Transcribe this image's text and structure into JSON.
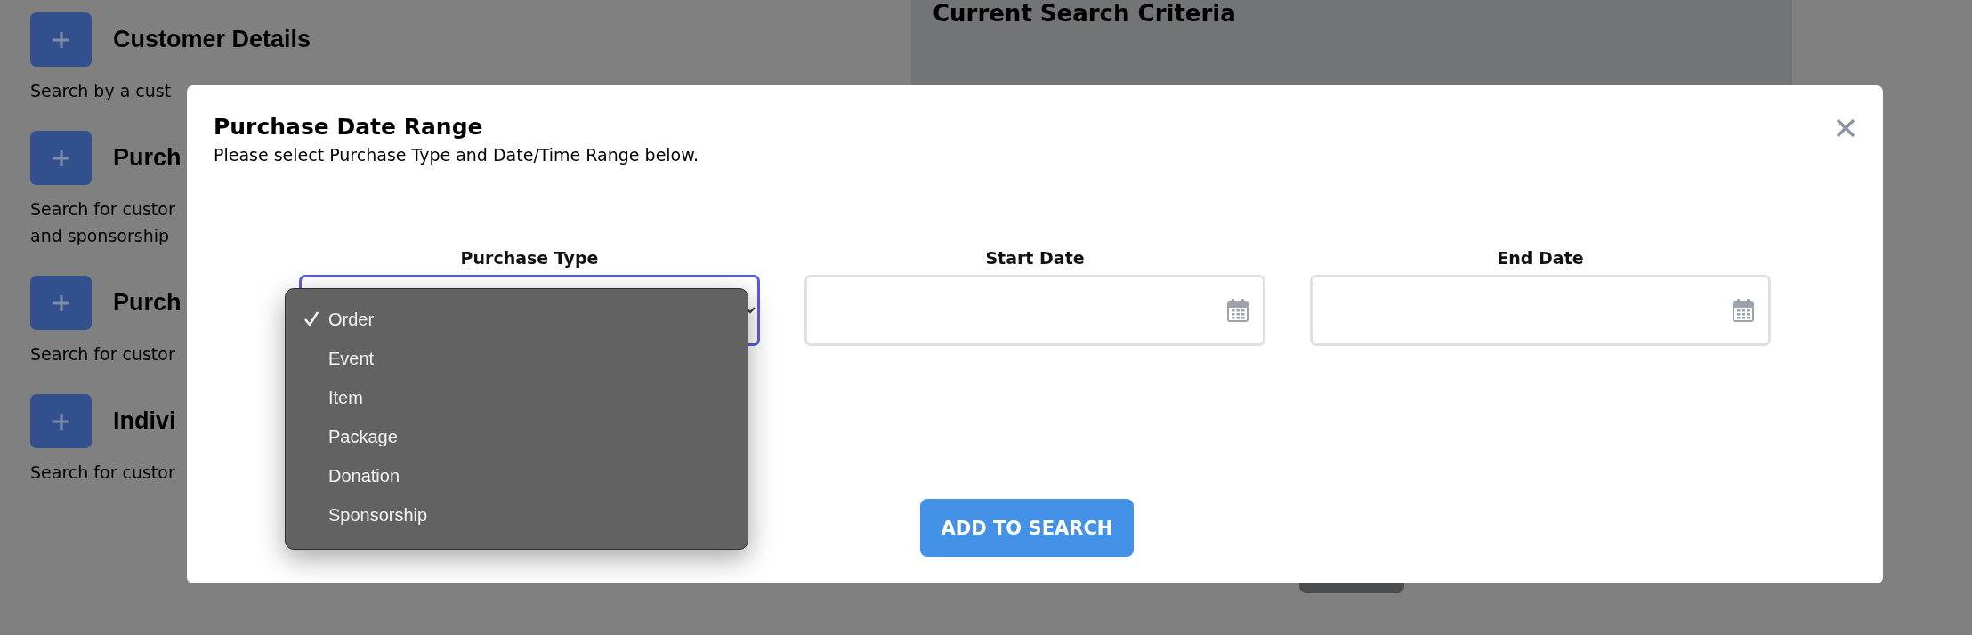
{
  "background": {
    "sections": [
      {
        "title": "Customer Details",
        "description": [
          "Search by a cust"
        ]
      },
      {
        "title": "Purch",
        "description": [
          "Search for custor",
          "and sponsorship"
        ]
      },
      {
        "title": "Purch",
        "description": [
          "Search for custor"
        ]
      },
      {
        "title": "Indivi",
        "description": [
          "Search for custor"
        ]
      }
    ],
    "criteria_panel": {
      "title": "Current Search Criteria"
    }
  },
  "modal": {
    "title": "Purchase Date Range",
    "subtitle": "Please select Purchase Type and Date/Time Range below.",
    "fields": [
      {
        "label": "Purchase Type",
        "kind": "select",
        "focused": true
      },
      {
        "label": "Start Date",
        "kind": "date",
        "focused": false
      },
      {
        "label": "End Date",
        "kind": "date",
        "focused": false
      }
    ],
    "dropdown": {
      "options": [
        {
          "label": "Order",
          "selected": true
        },
        {
          "label": "Event",
          "selected": false
        },
        {
          "label": "Item",
          "selected": false
        },
        {
          "label": "Package",
          "selected": false
        },
        {
          "label": "Donation",
          "selected": false
        },
        {
          "label": "Sponsorship",
          "selected": false
        }
      ]
    },
    "button": "ADD TO SEARCH"
  }
}
